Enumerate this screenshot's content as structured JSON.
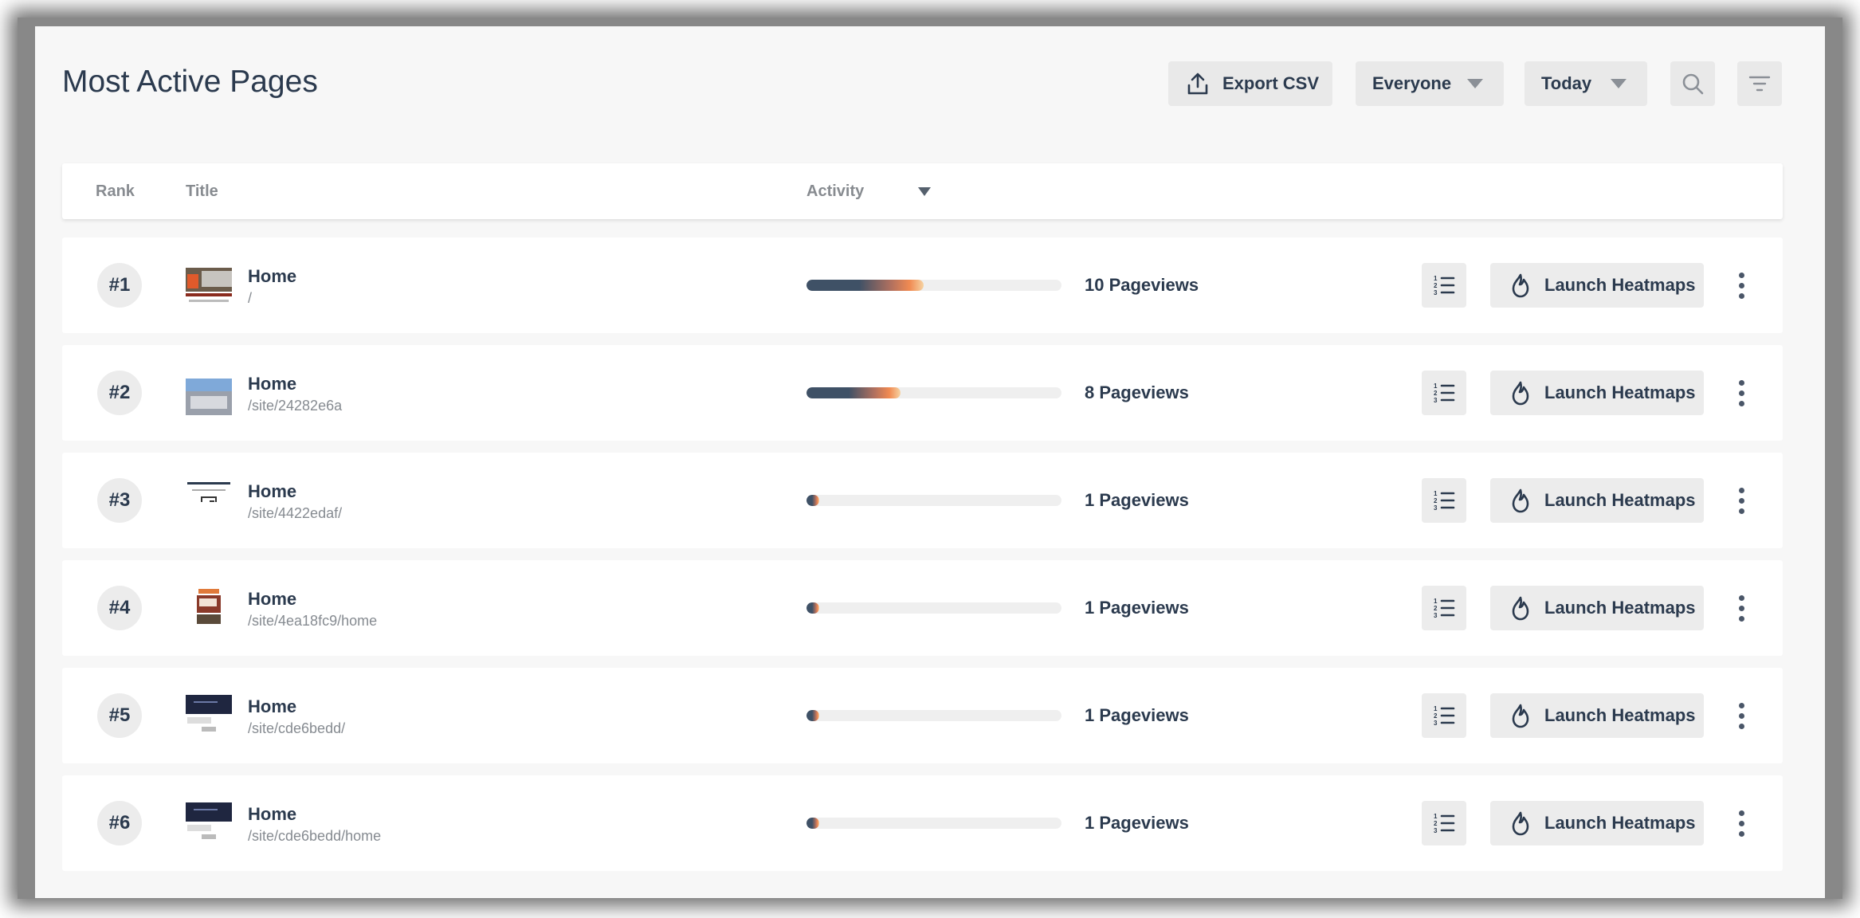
{
  "header": {
    "title": "Most Active Pages",
    "export_label": "Export CSV",
    "audience_value": "Everyone",
    "period_value": "Today"
  },
  "table": {
    "columns": [
      "Rank",
      "Title",
      "Activity"
    ]
  },
  "rows": [
    {
      "rank": "#1",
      "title": "Home",
      "path": "/",
      "activity": 0.46,
      "pageviews": "10 Pageviews",
      "heatmap_label": "Launch Heatmaps"
    },
    {
      "rank": "#2",
      "title": "Home",
      "path": "/site/24282e6a",
      "activity": 0.37,
      "pageviews": "8 Pageviews",
      "heatmap_label": "Launch Heatmaps"
    },
    {
      "rank": "#3",
      "title": "Home",
      "path": "/site/4422edaf/",
      "activity": 0.05,
      "pageviews": "1 Pageviews",
      "heatmap_label": "Launch Heatmaps"
    },
    {
      "rank": "#4",
      "title": "Home",
      "path": "/site/4ea18fc9/home",
      "activity": 0.05,
      "pageviews": "1 Pageviews",
      "heatmap_label": "Launch Heatmaps"
    },
    {
      "rank": "#5",
      "title": "Home",
      "path": "/site/cde6bedd/",
      "activity": 0.05,
      "pageviews": "1 Pageviews",
      "heatmap_label": "Launch Heatmaps"
    },
    {
      "rank": "#6",
      "title": "Home",
      "path": "/site/cde6bedd/home",
      "activity": 0.05,
      "pageviews": "1 Pageviews",
      "heatmap_label": "Launch Heatmaps"
    }
  ],
  "icons": {
    "export": "upload-icon",
    "search": "search-icon",
    "filter": "filter-icon",
    "ranking": "numbered-list-icon",
    "heatmap": "flame-icon",
    "more": "more-vertical-icon"
  },
  "colors": {
    "text": "#2b3a4e",
    "bar_dark": "#3f5166",
    "bar_accent": "#f08a52",
    "button_bg": "#ececec"
  }
}
